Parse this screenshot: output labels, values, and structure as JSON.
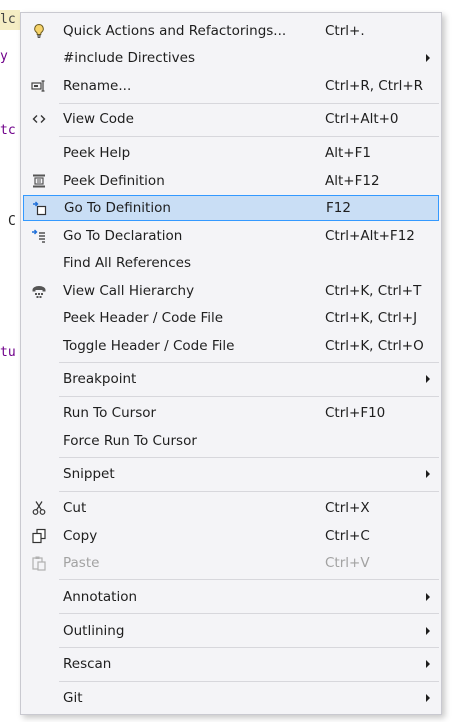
{
  "editor_fragments": [
    "lc",
    "y",
    "tc",
    "C",
    "tu"
  ],
  "menu": {
    "items": [
      {
        "label": "Quick Actions and Refactorings...",
        "shortcut": "Ctrl+.",
        "icon": "lightbulb-icon"
      },
      {
        "label": "#include Directives",
        "submenu": true
      },
      {
        "label": "Rename...",
        "shortcut": "Ctrl+R, Ctrl+R",
        "icon": "rename-icon"
      },
      {
        "label": "View Code",
        "shortcut": "Ctrl+Alt+0",
        "icon": "code-brackets-icon"
      },
      {
        "label": "Peek Help",
        "shortcut": "Alt+F1"
      },
      {
        "label": "Peek Definition",
        "shortcut": "Alt+F12",
        "icon": "peek-definition-icon"
      },
      {
        "label": "Go To Definition",
        "shortcut": "F12",
        "icon": "go-to-definition-icon",
        "selected": true
      },
      {
        "label": "Go To Declaration",
        "shortcut": "Ctrl+Alt+F12",
        "icon": "go-to-declaration-icon"
      },
      {
        "label": "Find All References"
      },
      {
        "label": "View Call Hierarchy",
        "shortcut": "Ctrl+K, Ctrl+T",
        "icon": "call-hierarchy-icon"
      },
      {
        "label": "Peek Header / Code File",
        "shortcut": "Ctrl+K, Ctrl+J"
      },
      {
        "label": "Toggle Header / Code File",
        "shortcut": "Ctrl+K, Ctrl+O"
      },
      {
        "label": "Breakpoint",
        "submenu": true
      },
      {
        "label": "Run To Cursor",
        "shortcut": "Ctrl+F10"
      },
      {
        "label": "Force Run To Cursor"
      },
      {
        "label": "Snippet",
        "submenu": true
      },
      {
        "label": "Cut",
        "shortcut": "Ctrl+X",
        "icon": "scissors-icon"
      },
      {
        "label": "Copy",
        "shortcut": "Ctrl+C",
        "icon": "copy-icon"
      },
      {
        "label": "Paste",
        "shortcut": "Ctrl+V",
        "icon": "paste-icon",
        "disabled": true
      },
      {
        "label": "Annotation",
        "submenu": true
      },
      {
        "label": "Outlining",
        "submenu": true
      },
      {
        "label": "Rescan",
        "submenu": true
      },
      {
        "label": "Git",
        "submenu": true
      }
    ]
  }
}
